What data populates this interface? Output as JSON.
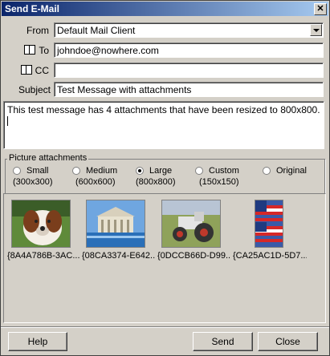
{
  "window": {
    "title": "Send E-Mail",
    "close_glyph": "✕"
  },
  "form": {
    "from_label": "From",
    "from_value": "Default Mail Client",
    "to_label": "To",
    "to_value": "johndoe@nowhere.com",
    "cc_label": "CC",
    "cc_value": "",
    "subject_label": "Subject",
    "subject_value": "Test Message with attachments",
    "message": "This test message has 4 attachments that have been resized to 800x800."
  },
  "attachments_group": {
    "title": "Picture attachments",
    "options": [
      {
        "label": "Small",
        "size": "(300x300)",
        "selected": false
      },
      {
        "label": "Medium",
        "size": "(600x600)",
        "selected": false
      },
      {
        "label": "Large",
        "size": "(800x800)",
        "selected": true
      },
      {
        "label": "Custom",
        "size": "(150x150)",
        "selected": false
      },
      {
        "label": "Original",
        "size": "",
        "selected": false
      }
    ]
  },
  "thumbnails": [
    {
      "caption": "{8A4A786B-3AC...",
      "depicts": "dog"
    },
    {
      "caption": "{08CA3374-E642...",
      "depicts": "building"
    },
    {
      "caption": "{0DCCB66D-D99...",
      "depicts": "tractor"
    },
    {
      "caption": "{CA25AC1D-5D7...",
      "depicts": "flag"
    }
  ],
  "buttons": {
    "help": "Help",
    "send": "Send",
    "close": "Close"
  }
}
